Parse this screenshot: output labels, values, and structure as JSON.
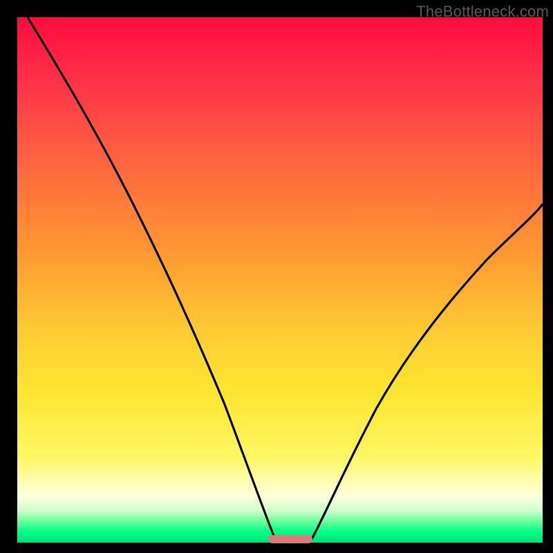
{
  "watermark": "TheBottleneck.com",
  "chart_data": {
    "type": "line",
    "title": "",
    "xlabel": "",
    "ylabel": "",
    "xlim": [
      0,
      100
    ],
    "ylim": [
      0,
      100
    ],
    "gradient_background": {
      "top_color": "#ff0b3d",
      "bottom_color": "#00dd77",
      "description": "red (high bottleneck) to green (low bottleneck)"
    },
    "series": [
      {
        "name": "left-curve",
        "x": [
          2,
          8,
          15,
          22,
          28,
          34,
          40,
          45,
          47,
          48,
          49
        ],
        "values": [
          100,
          91,
          80,
          68,
          56,
          42,
          27,
          11,
          4,
          1,
          0
        ]
      },
      {
        "name": "right-curve",
        "x": [
          56,
          58,
          62,
          68,
          75,
          82,
          90,
          100
        ],
        "values": [
          0,
          3,
          11,
          23,
          35,
          45,
          55,
          65
        ]
      }
    ],
    "marker": {
      "name": "optimal-range",
      "x_start": 48,
      "x_end": 56,
      "y": 0,
      "color": "#d87b7c"
    }
  }
}
